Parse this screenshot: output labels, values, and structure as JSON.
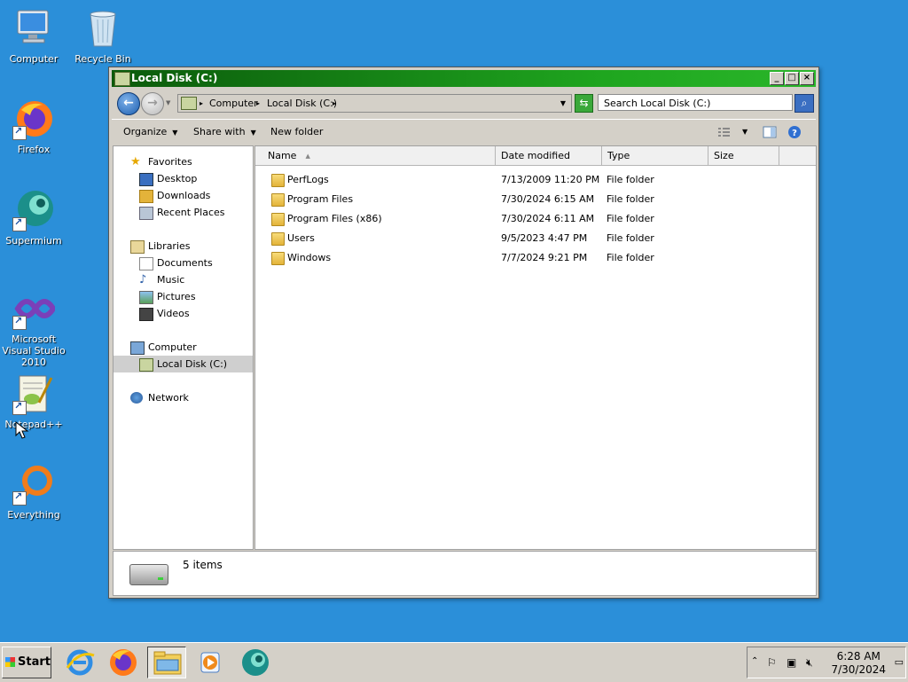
{
  "desktop": {
    "icons": [
      {
        "label": "Computer",
        "icon": "computer-icon"
      },
      {
        "label": "Recycle Bin",
        "icon": "recycle-bin-icon"
      },
      {
        "label": "Firefox",
        "icon": "firefox-icon"
      },
      {
        "label": "Supermium",
        "icon": "supermium-icon"
      },
      {
        "label": "Microsoft Visual Studio 2010",
        "icon": "visual-studio-icon"
      },
      {
        "label": "Notepad++",
        "icon": "notepadpp-icon"
      },
      {
        "label": "Everything",
        "icon": "everything-icon"
      }
    ]
  },
  "window": {
    "title": "Local Disk (C:)",
    "buttons": {
      "minimize": "_",
      "maximize": "□",
      "close": "×"
    },
    "address": {
      "segments": [
        "Computer",
        "Local Disk (C:)"
      ],
      "separator": "▸"
    },
    "search_placeholder": "Search Local Disk (C:)",
    "toolbar": {
      "organize": "Organize",
      "share_with": "Share with",
      "new_folder": "New folder"
    },
    "nav": {
      "favorites": "Favorites",
      "desktop": "Desktop",
      "downloads": "Downloads",
      "recent_places": "Recent Places",
      "libraries": "Libraries",
      "documents": "Documents",
      "music": "Music",
      "pictures": "Pictures",
      "videos": "Videos",
      "computer": "Computer",
      "local_disk": "Local Disk (C:)",
      "network": "Network"
    },
    "columns": {
      "name": "Name",
      "date": "Date modified",
      "type": "Type",
      "size": "Size"
    },
    "files": [
      {
        "name": "PerfLogs",
        "date": "7/13/2009 11:20 PM",
        "type": "File folder"
      },
      {
        "name": "Program Files",
        "date": "7/30/2024 6:15 AM",
        "type": "File folder"
      },
      {
        "name": "Program Files (x86)",
        "date": "7/30/2024 6:11 AM",
        "type": "File folder"
      },
      {
        "name": "Users",
        "date": "9/5/2023 4:47 PM",
        "type": "File folder"
      },
      {
        "name": "Windows",
        "date": "7/7/2024 9:21 PM",
        "type": "File folder"
      }
    ],
    "status": {
      "count": "5 items"
    }
  },
  "taskbar": {
    "start": "Start",
    "apps": [
      "internet-explorer-icon",
      "firefox-icon",
      "file-explorer-icon",
      "media-player-icon",
      "supermium-icon"
    ],
    "clock": {
      "time": "6:28 AM",
      "date": "7/30/2024"
    }
  }
}
